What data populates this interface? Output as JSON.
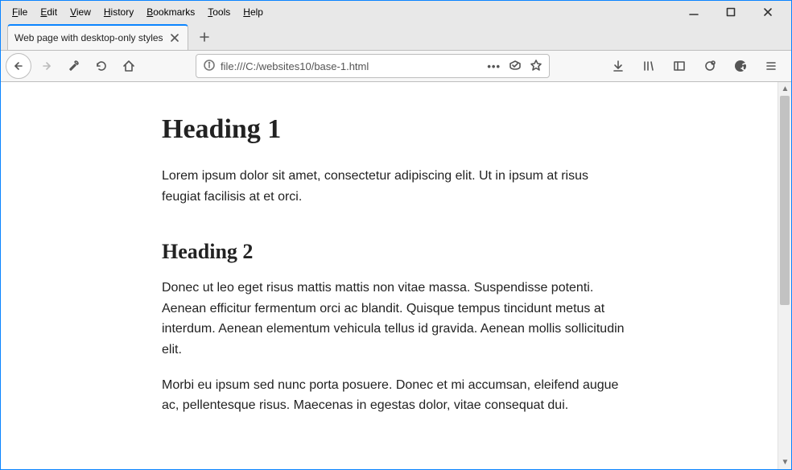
{
  "menubar": {
    "file": "File",
    "edit": "Edit",
    "view": "View",
    "history": "History",
    "bookmarks": "Bookmarks",
    "tools": "Tools",
    "help": "Help"
  },
  "tab": {
    "title": "Web page with desktop-only styles"
  },
  "addressbar": {
    "url": "file:///C:/websites10/base-1.html",
    "meatball": "•••"
  },
  "content": {
    "h1": "Heading 1",
    "p1": "Lorem ipsum dolor sit amet, consectetur adipiscing elit. Ut in ipsum at risus feugiat facilisis at et orci.",
    "h2": "Heading 2",
    "p2": "Donec ut leo eget risus mattis mattis non vitae massa. Suspendisse potenti. Aenean efficitur fermentum orci ac blandit. Quisque tempus tincidunt metus at interdum. Aenean elementum vehicula tellus id gravida. Aenean mollis sollicitudin elit.",
    "p3": "Morbi eu ipsum sed nunc porta posuere. Donec et mi accumsan, eleifend augue ac, pellentesque risus. Maecenas in egestas dolor, vitae consequat dui."
  }
}
